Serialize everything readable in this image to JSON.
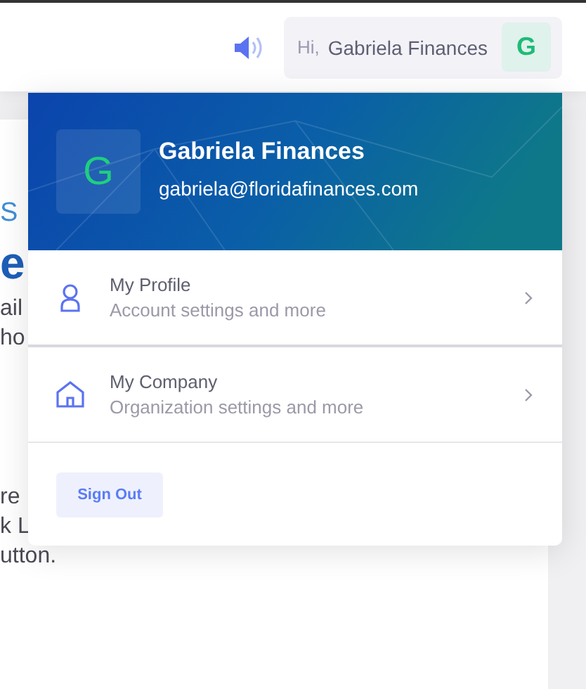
{
  "topbar": {
    "greeting": "Hi,",
    "user_name": "Gabriela Finances",
    "avatar_letter": "G"
  },
  "background_page": {
    "fragments": [
      {
        "kind": "label",
        "text": "S"
      },
      {
        "kind": "heading",
        "text": "e"
      },
      {
        "kind": "body",
        "text": "ail"
      },
      {
        "kind": "body",
        "text": "ho"
      },
      {
        "kind": "paragraph_start",
        "text": "re"
      },
      {
        "kind": "body",
        "text": "k L"
      },
      {
        "kind": "body",
        "text": "utton."
      }
    ]
  },
  "user_menu": {
    "avatar_letter": "G",
    "name": "Gabriela Finances",
    "email": "gabriela@floridafinances.com",
    "items": [
      {
        "kind": "profile",
        "title": "My Profile",
        "subtitle": "Account settings and more"
      },
      {
        "kind": "company",
        "title": "My Company",
        "subtitle": "Organization settings and more"
      }
    ],
    "sign_out": "Sign Out"
  }
}
